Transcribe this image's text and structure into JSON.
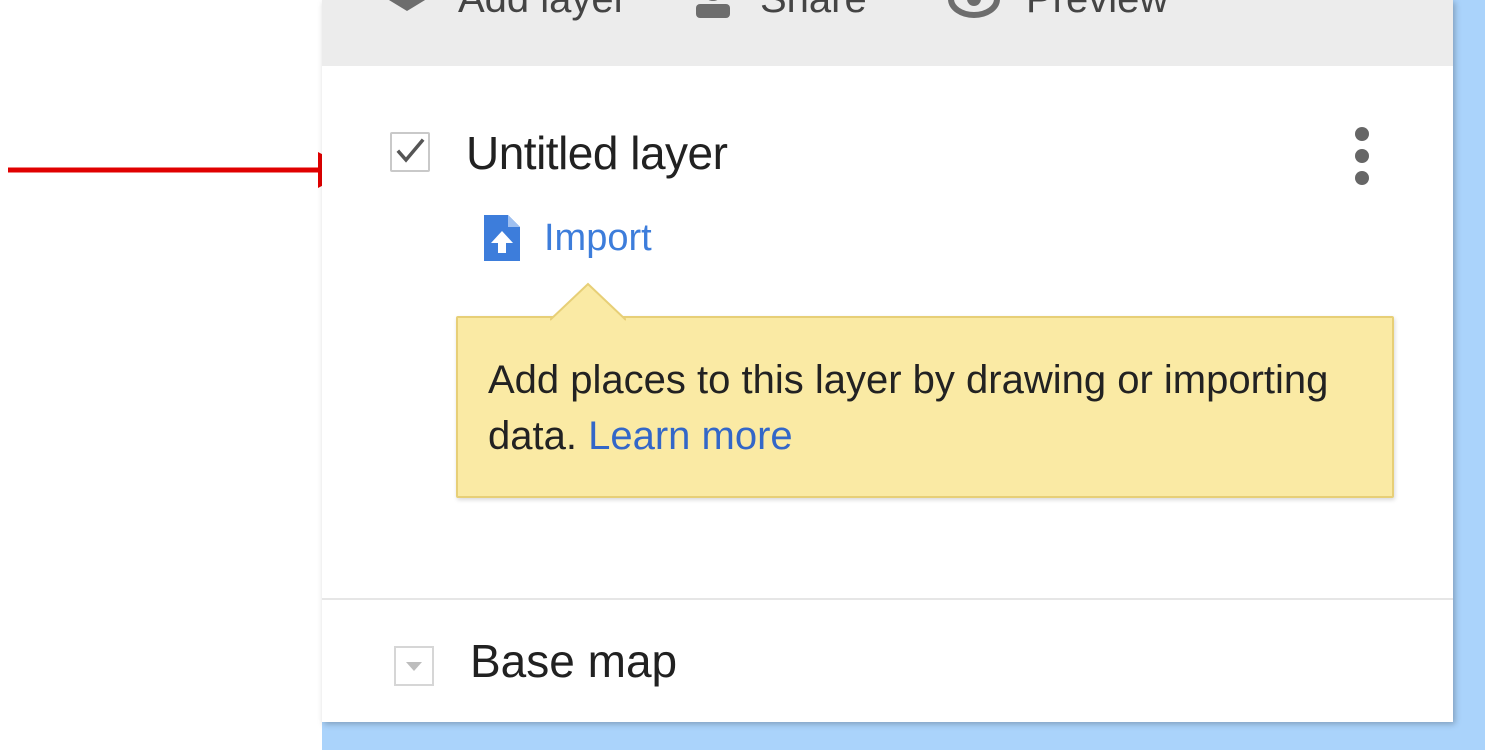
{
  "toolbar": {
    "add_layer_label": "Add layer",
    "share_label": "Share",
    "preview_label": "Preview"
  },
  "layer": {
    "title": "Untitled layer",
    "checked": true,
    "import_label": "Import"
  },
  "tooltip": {
    "message": "Add places to this layer by drawing or importing data.",
    "link_label": "Learn more"
  },
  "base_map": {
    "title": "Base map"
  },
  "icons": {
    "add_layer": "add-layer-icon",
    "share": "person-icon",
    "preview": "eye-icon",
    "checkbox": "checkmark-icon",
    "more": "more-vert-icon",
    "import": "file-upload-icon",
    "dropdown": "triangle-down-icon",
    "annotation": "arrow-right-icon"
  },
  "colors": {
    "annotation_arrow": "#e00000",
    "link": "#3d7ddb",
    "tooltip_bg": "#faeaa4",
    "map_water": "#aad3fb"
  }
}
